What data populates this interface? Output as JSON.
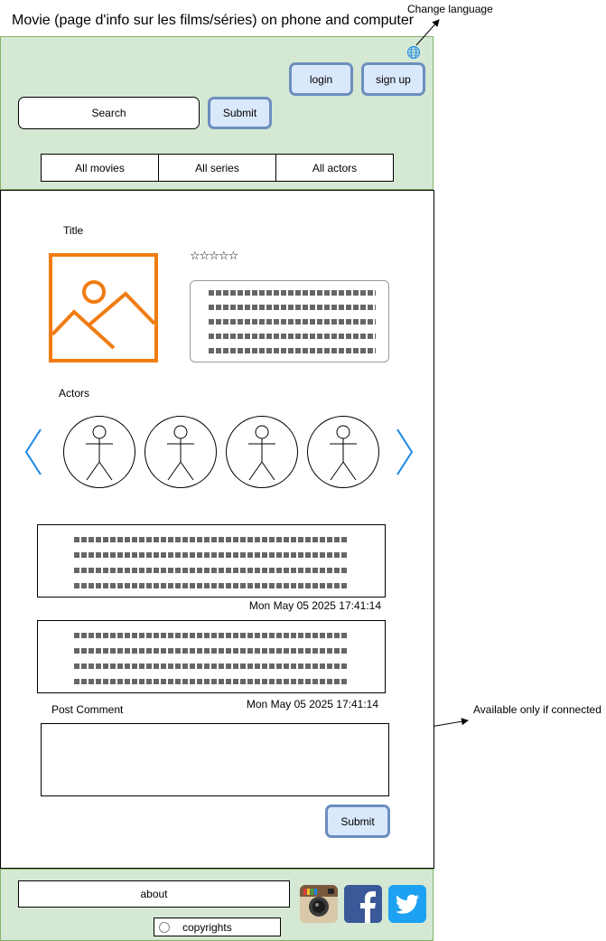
{
  "page_title": "Movie (page d'info sur les films/séries) on phone and computer",
  "annotations": {
    "change_language": "Change language",
    "available_if_connected": "Available only if connected"
  },
  "header": {
    "login_label": "login",
    "signup_label": "sign up",
    "search_placeholder": "Search",
    "search_submit_label": "Submit",
    "tabs": [
      {
        "label": "All movies"
      },
      {
        "label": "All series"
      },
      {
        "label": "All actors"
      }
    ]
  },
  "detail": {
    "title_label": "Title",
    "rating_stars": "☆☆☆☆☆",
    "actors_label": "Actors"
  },
  "comments": [
    {
      "timestamp": "Mon May 05 2025 17:41:14"
    },
    {
      "timestamp": "Mon May 05 2025 17:41:14"
    }
  ],
  "post_comment": {
    "label": "Post Comment",
    "submit_label": "Submit"
  },
  "footer": {
    "about_label": "about",
    "copyright_label": "copyrights"
  },
  "colors": {
    "panel_green": "#d5e8d4",
    "button_blue": "#dae8fc",
    "button_border": "#6c8ebf",
    "image_orange": "#f07c12",
    "chevron_blue": "#1e88e5"
  }
}
